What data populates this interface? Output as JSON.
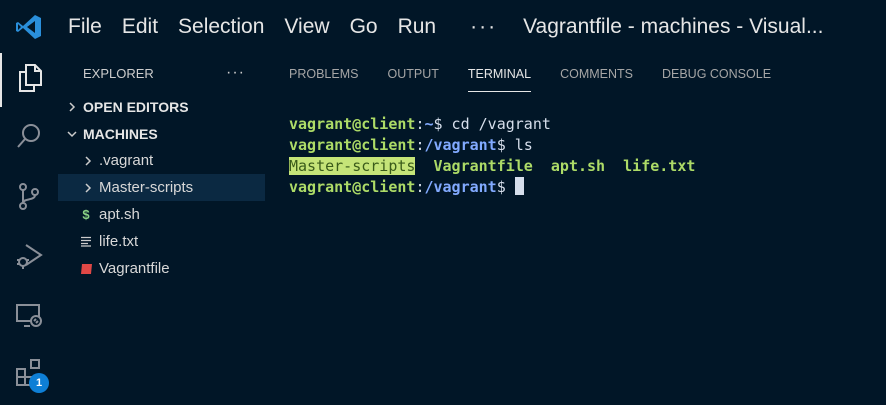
{
  "titlebar": {
    "menu": [
      "File",
      "Edit",
      "Selection",
      "View",
      "Go",
      "Run"
    ],
    "more": "···",
    "window_title": "Vagrantfile - machines - Visual..."
  },
  "activitybar": {
    "icons": [
      "files-icon",
      "search-icon",
      "source-control-icon",
      "run-debug-icon",
      "remote-explorer-icon",
      "extensions-icon"
    ],
    "extensions_badge": "1"
  },
  "sidebar": {
    "title": "EXPLORER",
    "more": "···",
    "open_editors": "OPEN EDITORS",
    "machines": "MACHINES",
    "items": [
      {
        "label": ".vagrant",
        "type": "folder"
      },
      {
        "label": "Master-scripts",
        "type": "folder"
      },
      {
        "label": "apt.sh",
        "type": "shell"
      },
      {
        "label": "life.txt",
        "type": "text"
      },
      {
        "label": "Vagrantfile",
        "type": "vagrant"
      }
    ]
  },
  "panel": {
    "tabs": [
      "PROBLEMS",
      "OUTPUT",
      "TERMINAL",
      "COMMENTS",
      "DEBUG CONSOLE"
    ],
    "active_tab": "TERMINAL"
  },
  "terminal": {
    "user_host": "vagrant@client",
    "line1": {
      "path": "~",
      "cmd": " cd /vagrant"
    },
    "line2": {
      "path": "/vagrant",
      "cmd": " ls"
    },
    "ls": {
      "dir": "Master-scripts",
      "files": [
        "Vagrantfile",
        "apt.sh",
        "life.txt"
      ]
    },
    "line4": {
      "path": "/vagrant"
    }
  },
  "colors": {
    "background": "#011627",
    "prompt_green": "#addb67",
    "path_blue": "#82aaff",
    "accent": "#0e7fd6"
  }
}
